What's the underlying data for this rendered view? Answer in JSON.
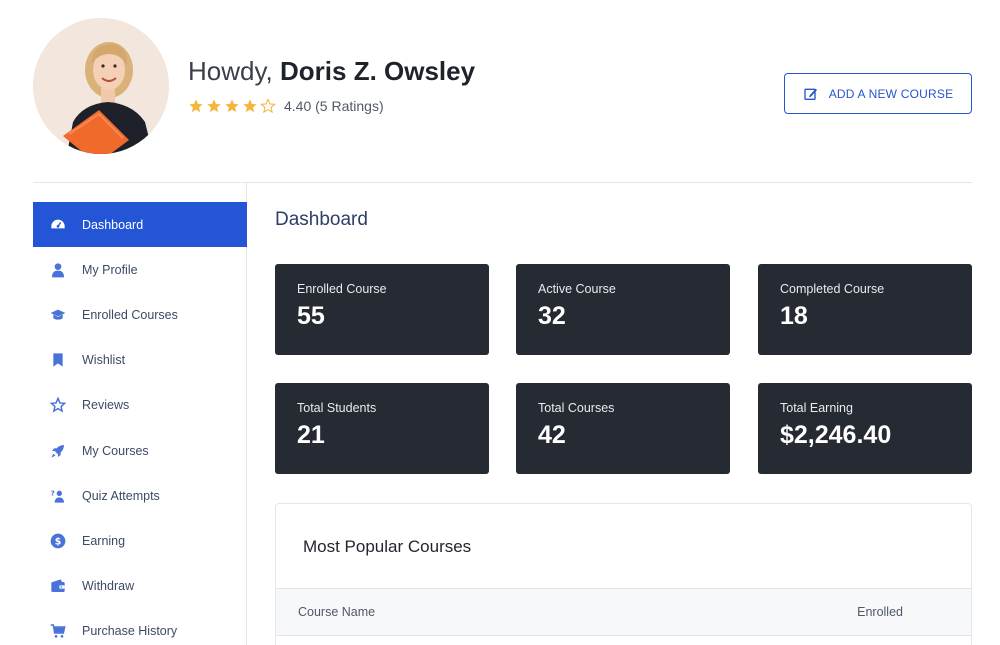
{
  "header": {
    "greeting": "Howdy,",
    "user_name": "Doris Z. Owsley",
    "rating_value": 4.4,
    "rating_text": "4.40 (5 Ratings)",
    "add_course_label": "ADD A NEW COURSE"
  },
  "sidebar": {
    "items": [
      {
        "label": "Dashboard",
        "icon": "dashboard-icon",
        "active": true
      },
      {
        "label": "My Profile",
        "icon": "user-icon"
      },
      {
        "label": "Enrolled Courses",
        "icon": "graduation-cap-icon"
      },
      {
        "label": "Wishlist",
        "icon": "bookmark-icon"
      },
      {
        "label": "Reviews",
        "icon": "star-icon"
      },
      {
        "label": "My Courses",
        "icon": "rocket-icon"
      },
      {
        "label": "Quiz Attempts",
        "icon": "quiz-icon"
      },
      {
        "label": "Earning",
        "icon": "dollar-icon"
      },
      {
        "label": "Withdraw",
        "icon": "wallet-icon"
      },
      {
        "label": "Purchase History",
        "icon": "cart-icon"
      }
    ]
  },
  "main": {
    "title": "Dashboard",
    "stats": [
      {
        "label": "Enrolled Course",
        "value": "55"
      },
      {
        "label": "Active Course",
        "value": "32"
      },
      {
        "label": "Completed Course",
        "value": "18"
      },
      {
        "label": "Total Students",
        "value": "21"
      },
      {
        "label": "Total Courses",
        "value": "42"
      },
      {
        "label": "Total Earning",
        "value": "$2,246.40"
      }
    ],
    "popular": {
      "title": "Most Popular Courses",
      "columns": [
        "Course Name",
        "Enrolled"
      ]
    }
  },
  "colors": {
    "accent": "#2455d6",
    "card_bg": "#262a33",
    "star": "#f4b63f",
    "sidebar_icon": "#4a72d8"
  }
}
